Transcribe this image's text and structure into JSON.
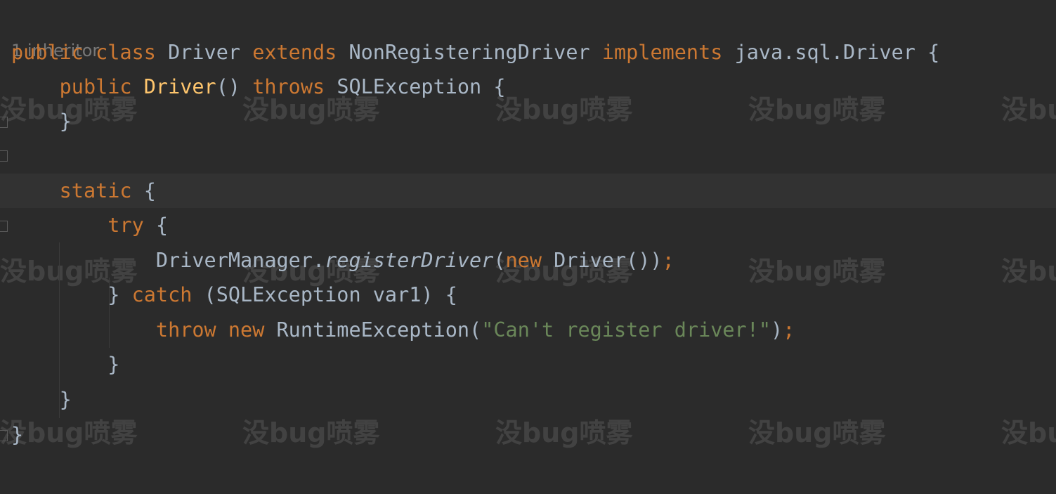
{
  "editor": {
    "hint": "1 inheritor",
    "lines": [
      [
        {
          "t": "public",
          "c": "kw"
        },
        {
          "t": " "
        },
        {
          "t": "class",
          "c": "kw"
        },
        {
          "t": " Driver "
        },
        {
          "t": "extends",
          "c": "kw"
        },
        {
          "t": " NonRegisteringDriver "
        },
        {
          "t": "implements",
          "c": "kw"
        },
        {
          "t": " java.sql.Driver {"
        }
      ],
      [
        {
          "t": "    "
        },
        {
          "t": "public",
          "c": "kw"
        },
        {
          "t": " "
        },
        {
          "t": "Driver",
          "c": "fn"
        },
        {
          "t": "() "
        },
        {
          "t": "throws",
          "c": "kw"
        },
        {
          "t": " SQLException {"
        }
      ],
      [
        {
          "t": "    }"
        }
      ],
      [],
      [
        {
          "t": "    "
        },
        {
          "t": "static",
          "c": "kw"
        },
        {
          "t": " {"
        }
      ],
      [
        {
          "t": "        "
        },
        {
          "t": "try",
          "c": "kw"
        },
        {
          "t": " {"
        }
      ],
      [
        {
          "t": "            DriverManager."
        },
        {
          "t": "registerDriver",
          "c": "it"
        },
        {
          "t": "("
        },
        {
          "t": "new",
          "c": "kw"
        },
        {
          "t": " Driver())"
        },
        {
          "t": ";",
          "c": "kw"
        }
      ],
      [
        {
          "t": "        } "
        },
        {
          "t": "catch",
          "c": "kw"
        },
        {
          "t": " (SQLException var1) {"
        }
      ],
      [
        {
          "t": "            "
        },
        {
          "t": "throw",
          "c": "kw"
        },
        {
          "t": " "
        },
        {
          "t": "new",
          "c": "kw"
        },
        {
          "t": " RuntimeException("
        },
        {
          "t": "\"Can't register driver!\"",
          "c": "str"
        },
        {
          "t": ")"
        },
        {
          "t": ";",
          "c": "kw"
        }
      ],
      [
        {
          "t": "        }"
        }
      ],
      [
        {
          "t": "    }"
        }
      ],
      [
        {
          "t": "}"
        }
      ]
    ]
  },
  "watermark": {
    "text": "没bug喷雾"
  },
  "colors": {
    "background": "#2b2b2b",
    "keyword": "#cc7832",
    "function": "#ffc66d",
    "string": "#6a8759",
    "default": "#a9b7c6",
    "hint": "#787878"
  }
}
